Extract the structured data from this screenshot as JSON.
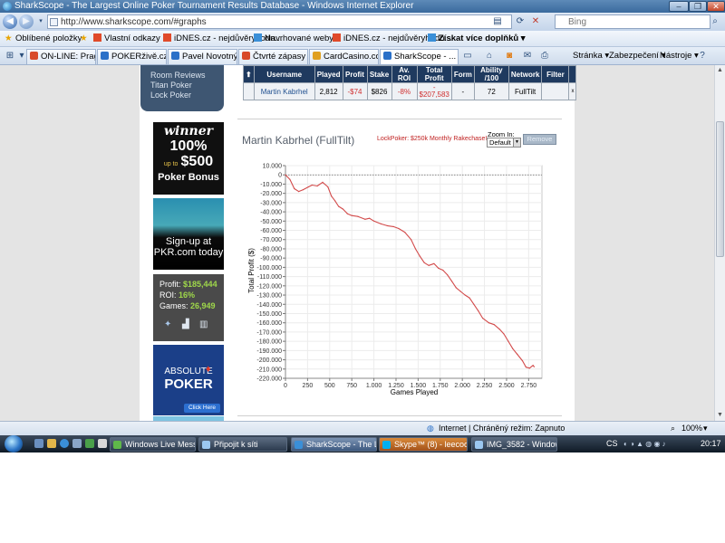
{
  "window": {
    "title": "SharkScope - The Largest Online Poker Tournament Results Database - Windows Internet Explorer",
    "url": "http://www.sharkscope.com/#graphs",
    "search_placeholder": "Bing"
  },
  "favorites_bar": {
    "favorites_label": "Oblíbené položky",
    "items": [
      "Vlastní odkazy",
      "iDNES.cz - nejdůvěryhodn...",
      "Navrhované weby ▾",
      "iDNES.cz - nejdůvěryhodn...",
      "Získat více doplňků ▾"
    ]
  },
  "tabs": [
    {
      "label": "ON-LINE: Prague..."
    },
    {
      "label": "POKERživě.cz CMS"
    },
    {
      "label": "Pavel Novotný (4..."
    },
    {
      "label": "Čtvrté zápasy př..."
    },
    {
      "label": "CardCasino.com..."
    },
    {
      "label": "SharkScope - ...",
      "active": true
    }
  ],
  "commands": {
    "page": "Stránka ▾",
    "safety": "Zabezpečení ▾",
    "tools": "Nástroje ▾"
  },
  "site": {
    "nav_links": [
      "Room Reviews",
      "Titan Poker",
      "Lock Poker"
    ],
    "ad_winner": {
      "brand": "winner",
      "amount_pct": "100%",
      "upto": "up to",
      "amount": "$500",
      "tagline": "Poker Bonus"
    },
    "ad_pkr": {
      "line1": "Sign-up at",
      "line2": "PKR.com today"
    },
    "stats": {
      "profit_label": "Profit:",
      "profit_value": "$185,444",
      "roi_label": "ROI:",
      "roi_value": "16%",
      "games_label": "Games:",
      "games_value": "26,949"
    },
    "ad_absolute": {
      "line1": "ABSOLUTE",
      "line2": "POKER",
      "cta": "Click Here"
    }
  },
  "results_table": {
    "headers": [
      "Username",
      "Played",
      "Profit",
      "Stake",
      "Av. ROI",
      "Total Profit",
      "Form",
      "Ability /100",
      "Network",
      "Filter"
    ],
    "row": [
      "Martin Kabrhel",
      "2,812",
      "-$74",
      "$826",
      "-8%",
      "-$207,583",
      "-",
      "72",
      "FullTilt",
      ""
    ],
    "total_profit_prefix": "-",
    "total_profit_value": "$207,583"
  },
  "graph": {
    "title": "Martin Kabrhel (FullTilt)",
    "promo": "LockPoker: $250k Monthly Rakechase!",
    "zoom_label": "Zoom In:",
    "zoom_value": "Default",
    "remove_label": "Remove"
  },
  "chart_data": {
    "type": "line",
    "title": "",
    "xlabel": "Games Played",
    "ylabel": "Total Profit ($)",
    "xlim": [
      0,
      2900
    ],
    "ylim": [
      -220000,
      10000
    ],
    "x_ticks": [
      0,
      250,
      500,
      750,
      1000,
      1250,
      1500,
      1750,
      2000,
      2250,
      2500,
      2750
    ],
    "x_tick_labels": [
      "0",
      "250",
      "500",
      "750",
      "1.000",
      "1.250",
      "1.500",
      "1.750",
      "2.000",
      "2.250",
      "2.500",
      "2.750"
    ],
    "y_ticks": [
      10000,
      0,
      -10000,
      -20000,
      -30000,
      -40000,
      -50000,
      -60000,
      -70000,
      -80000,
      -90000,
      -100000,
      -110000,
      -120000,
      -130000,
      -140000,
      -150000,
      -160000,
      -170000,
      -180000,
      -190000,
      -200000,
      -210000,
      -220000
    ],
    "y_tick_labels": [
      "10.000",
      "0",
      "-10.000",
      "-20.000",
      "-30.000",
      "-40.000",
      "-50.000",
      "-60.000",
      "-70.000",
      "-80.000",
      "-90.000",
      "-100.000",
      "-110.000",
      "-120.000",
      "-130.000",
      "-140.000",
      "-150.000",
      "-160.000",
      "-170.000",
      "-180.000",
      "-190.000",
      "-200.000",
      "-210.000",
      "-220.000"
    ],
    "grid": true,
    "zero_line": true,
    "series": [
      {
        "color": "#d24a4a",
        "points": [
          [
            0,
            0
          ],
          [
            50,
            -5000
          ],
          [
            100,
            -15000
          ],
          [
            150,
            -18000
          ],
          [
            200,
            -16000
          ],
          [
            260,
            -13000
          ],
          [
            300,
            -11000
          ],
          [
            360,
            -12000
          ],
          [
            420,
            -8000
          ],
          [
            480,
            -13000
          ],
          [
            520,
            -23000
          ],
          [
            560,
            -28000
          ],
          [
            600,
            -34000
          ],
          [
            650,
            -37000
          ],
          [
            700,
            -42000
          ],
          [
            750,
            -44000
          ],
          [
            820,
            -45000
          ],
          [
            900,
            -48000
          ],
          [
            950,
            -47000
          ],
          [
            1000,
            -50000
          ],
          [
            1080,
            -53000
          ],
          [
            1150,
            -55000
          ],
          [
            1220,
            -56000
          ],
          [
            1280,
            -58000
          ],
          [
            1350,
            -62000
          ],
          [
            1420,
            -70000
          ],
          [
            1470,
            -80000
          ],
          [
            1520,
            -88000
          ],
          [
            1570,
            -95000
          ],
          [
            1620,
            -98000
          ],
          [
            1680,
            -96000
          ],
          [
            1730,
            -101000
          ],
          [
            1780,
            -103000
          ],
          [
            1830,
            -108000
          ],
          [
            1880,
            -115000
          ],
          [
            1930,
            -122000
          ],
          [
            1980,
            -126000
          ],
          [
            2030,
            -130000
          ],
          [
            2080,
            -133000
          ],
          [
            2130,
            -140000
          ],
          [
            2180,
            -147000
          ],
          [
            2230,
            -155000
          ],
          [
            2300,
            -160000
          ],
          [
            2360,
            -162000
          ],
          [
            2420,
            -167000
          ],
          [
            2470,
            -172000
          ],
          [
            2520,
            -180000
          ],
          [
            2570,
            -188000
          ],
          [
            2620,
            -194000
          ],
          [
            2680,
            -201000
          ],
          [
            2720,
            -208000
          ],
          [
            2760,
            -209000
          ],
          [
            2800,
            -206000
          ],
          [
            2812,
            -207583
          ]
        ]
      }
    ]
  },
  "status": {
    "zone": "Internet | Chráněný režim: Zapnuto",
    "zoom": "100%"
  },
  "taskbar": {
    "items": [
      "Windows Live Mess...",
      "Připojit k síti",
      "SharkScope - The La...",
      "Skype™ (8) - leecoo...",
      "IMG_3582 - Window..."
    ],
    "lang": "CS",
    "clock": "20:17"
  }
}
